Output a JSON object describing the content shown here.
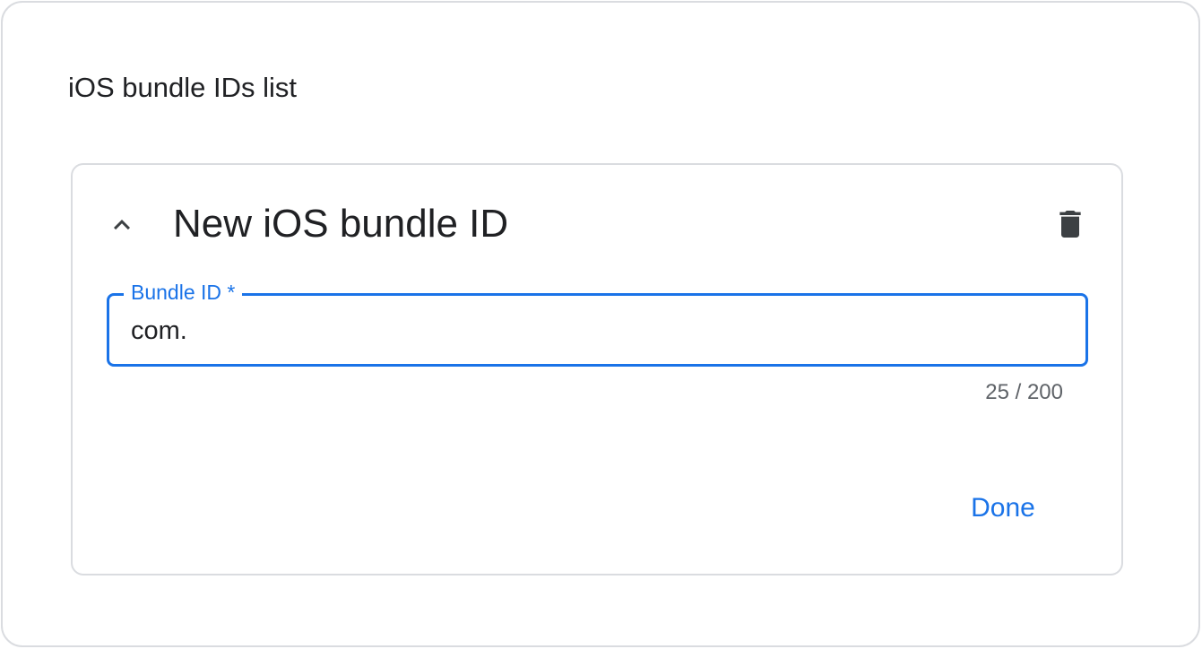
{
  "section": {
    "title": "iOS bundle IDs list"
  },
  "card": {
    "title": "New iOS bundle ID",
    "collapse_icon": "chevron-up-icon",
    "delete_icon": "delete-icon",
    "field": {
      "label": "Bundle ID *",
      "value": "com.",
      "counter": "25 / 200"
    },
    "done_label": "Done"
  },
  "colors": {
    "accent": "#1a73e8",
    "text_primary": "#202124",
    "text_secondary": "#5f6368",
    "border": "#dadce0",
    "icon": "#3c4043"
  }
}
